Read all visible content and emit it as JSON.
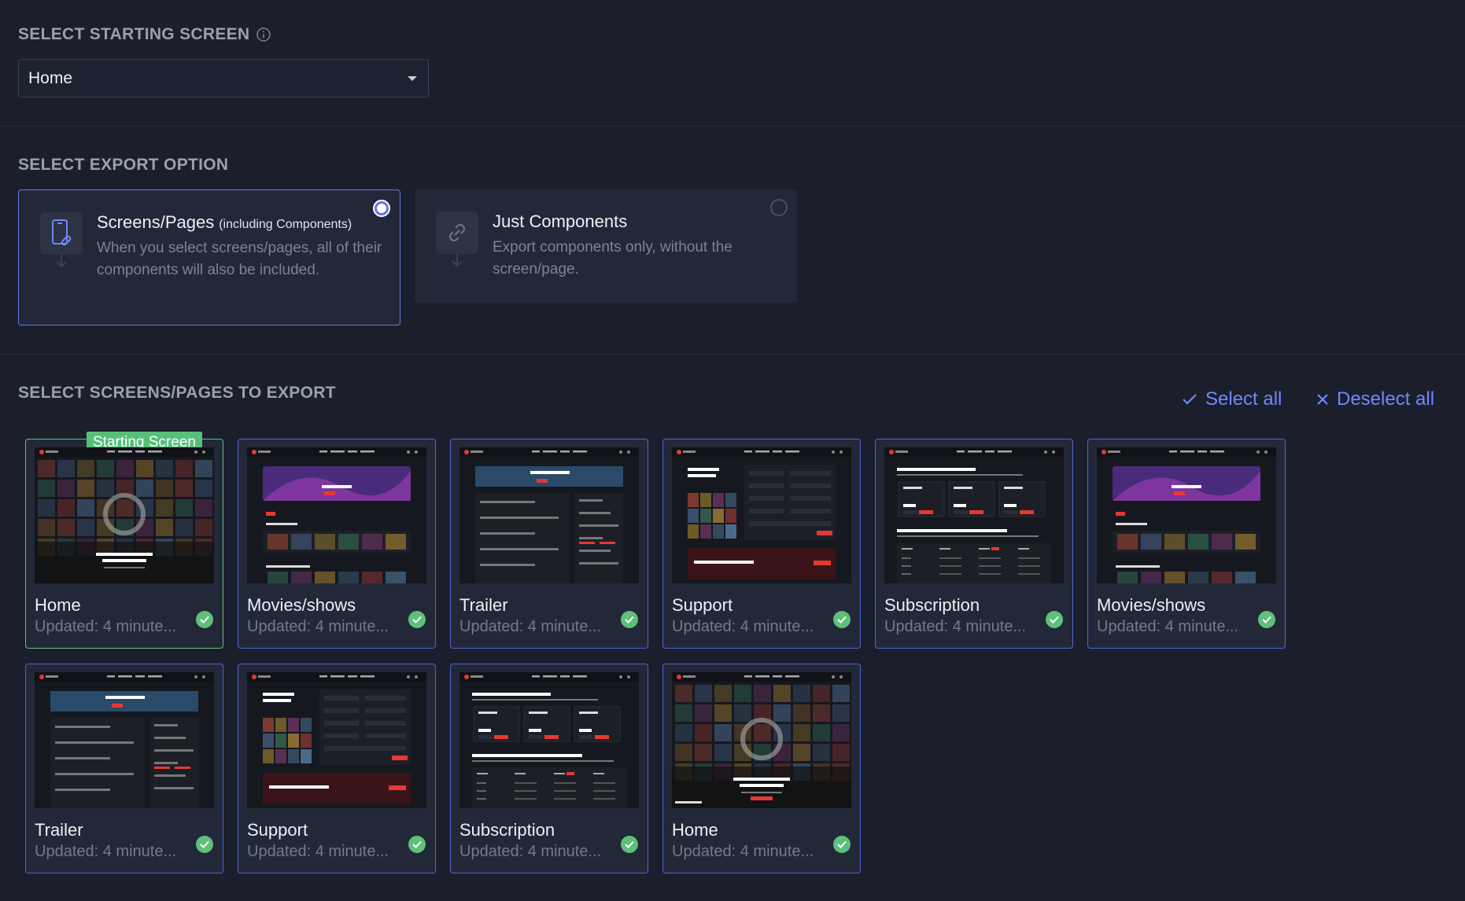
{
  "starting_screen": {
    "title": "SELECT STARTING SCREEN",
    "selected": "Home"
  },
  "export_option": {
    "title": "SELECT EXPORT OPTION",
    "options": [
      {
        "title": "Screens/Pages",
        "note": "(including Components)",
        "desc": "When you select screens/pages, all of their components will also be included.",
        "selected": true
      },
      {
        "title": "Just Components",
        "note": "",
        "desc": "Export components only, without the screen/page.",
        "selected": false
      }
    ]
  },
  "screens": {
    "title": "SELECT SCREENS/PAGES TO EXPORT",
    "select_all": "Select all",
    "deselect_all": "Deselect all",
    "starting_badge": "Starting Screen",
    "items": [
      {
        "name": "Home",
        "updated": "Updated: 4 minute..."
      },
      {
        "name": "Movies/shows",
        "updated": "Updated: 4 minute..."
      },
      {
        "name": "Trailer",
        "updated": "Updated: 4 minute..."
      },
      {
        "name": "Support",
        "updated": "Updated: 4 minute..."
      },
      {
        "name": "Subscription",
        "updated": "Updated: 4 minute..."
      },
      {
        "name": "Movies/shows",
        "updated": "Updated: 4 minute..."
      },
      {
        "name": "Trailer",
        "updated": "Updated: 4 minute..."
      },
      {
        "name": "Support",
        "updated": "Updated: 4 minute..."
      },
      {
        "name": "Subscription",
        "updated": "Updated: 4 minute..."
      },
      {
        "name": "Home",
        "updated": "Updated: 4 minute..."
      }
    ]
  },
  "colors": {
    "accent": "#6f88ff",
    "selected_border": "#4f66d8",
    "success": "#5ec07a",
    "background": "#1b1f2c"
  }
}
